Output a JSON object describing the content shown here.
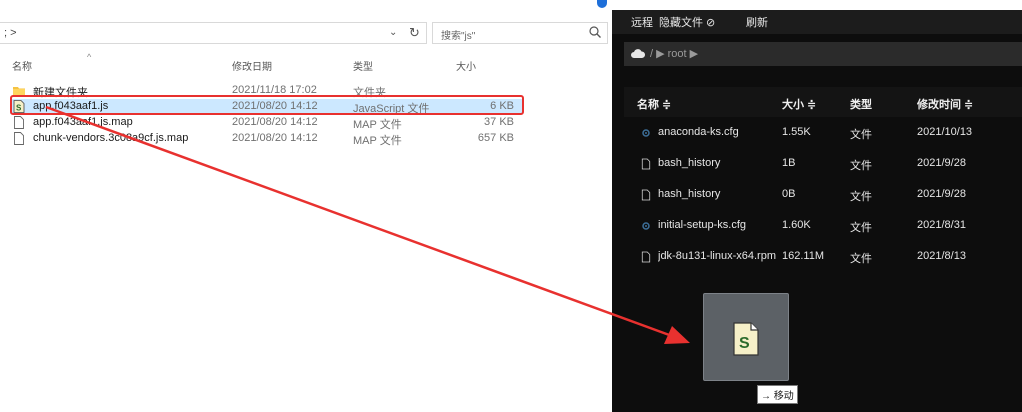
{
  "explorer": {
    "address": "; >",
    "search_placeholder": "搜索\"js\"",
    "columns": {
      "name": "名称",
      "date": "修改日期",
      "type": "类型",
      "size": "大小"
    },
    "files": [
      {
        "name": "新建文件夹",
        "date": "2021/11/18 17:02",
        "type": "文件夹",
        "size": "",
        "icon": "folder-icon",
        "selected": false
      },
      {
        "name": "app.f043aaf1.js",
        "date": "2021/08/20 14:12",
        "type": "JavaScript 文件",
        "size": "6 KB",
        "icon": "js-file-icon",
        "selected": true
      },
      {
        "name": "app.f043aaf1.js.map",
        "date": "2021/08/20 14:12",
        "type": "MAP 文件",
        "size": "37 KB",
        "icon": "file-icon",
        "selected": false
      },
      {
        "name": "chunk-vendors.3c08a9cf.js.map",
        "date": "2021/08/20 14:12",
        "type": "MAP 文件",
        "size": "657 KB",
        "icon": "file-icon",
        "selected": false
      }
    ]
  },
  "remote": {
    "toolbar": {
      "remote": "远程",
      "hidden_files": "隐藏文件 ⊘",
      "refresh": "刷新"
    },
    "breadcrumb": "/ ▶ root ▶",
    "columns": {
      "name": "名称 ≑",
      "size": "大小 ≑",
      "type": "类型",
      "modified": "修改时间 ≑"
    },
    "files": [
      {
        "name": "anaconda-ks.cfg",
        "size": "1.55K",
        "type": "文件",
        "modified": "2021/10/13",
        "icon": "gear-file-icon"
      },
      {
        "name": "bash_history",
        "size": "1B",
        "type": "文件",
        "modified": "2021/9/28",
        "icon": "file-icon"
      },
      {
        "name": "hash_history",
        "size": "0B",
        "type": "文件",
        "modified": "2021/9/28",
        "icon": "file-icon"
      },
      {
        "name": "initial-setup-ks.cfg",
        "size": "1.60K",
        "type": "文件",
        "modified": "2021/8/31",
        "icon": "gear-file-icon"
      },
      {
        "name": "jdk-8u131-linux-x64.rpm",
        "size": "162.11M",
        "type": "文件",
        "modified": "2021/8/13",
        "icon": "file-icon"
      }
    ],
    "drag_tooltip": "→ 移动"
  },
  "colors": {
    "annotation_red": "#e8312f",
    "selection_blue": "#cce8ff",
    "panel_dark": "#0d0d0d"
  }
}
